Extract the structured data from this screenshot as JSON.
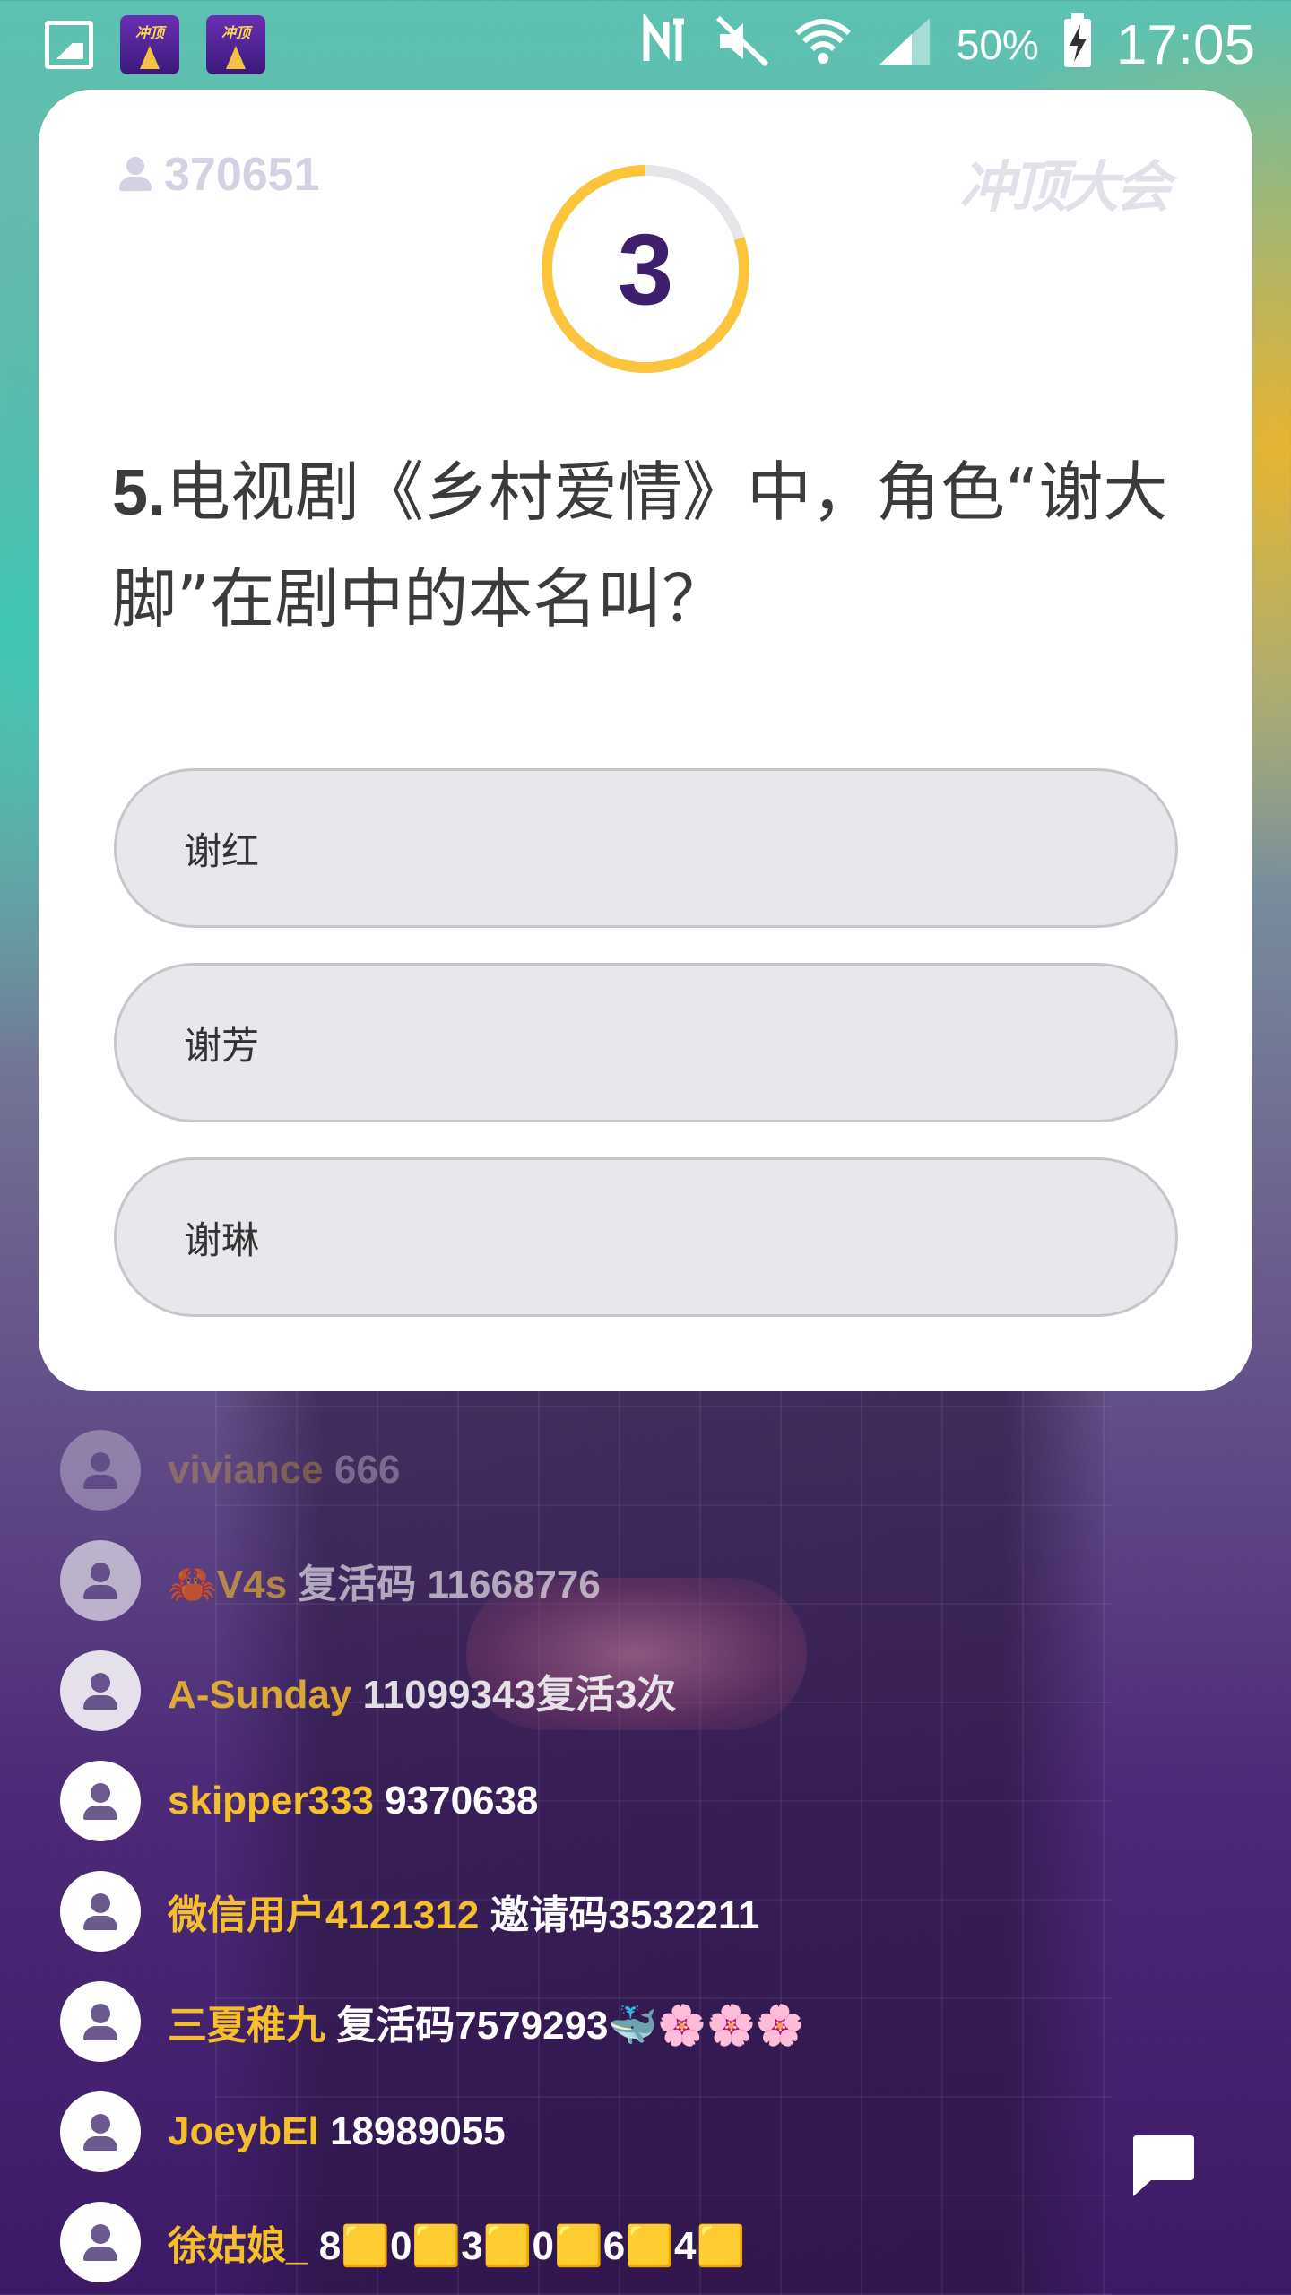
{
  "status_bar": {
    "battery": "50%",
    "time": "17:05",
    "app_icon_text": "冲顶"
  },
  "card": {
    "viewer_count": "370651",
    "logo_text": "冲顶大会",
    "countdown": "3",
    "countdown_progress": 0.8,
    "question_number": "5.",
    "question_text": "电视剧《乡村爱情》中，角色“谢大脚”在剧中的本名叫？",
    "options": [
      "谢红",
      "谢芳",
      "谢琳"
    ]
  },
  "comments": [
    {
      "user": "viviance",
      "message": " 666"
    },
    {
      "user": "🦀V4s",
      "message": " 复活码 11668776"
    },
    {
      "user": "A-Sunday",
      "message": " 11099343复活3次"
    },
    {
      "user": "skipper333",
      "message": " 9370638"
    },
    {
      "user": "微信用户4121312",
      "message": " 邀请码3532211"
    },
    {
      "user": "三夏稚九",
      "message": " 复活码7579293🐳🌸🌸🌸"
    },
    {
      "user": "JoeybEl",
      "message": " 18989055"
    },
    {
      "user": "徐姑娘_",
      "message": " 8🟨0🟨3🟨0🟨6🟨4🟨"
    }
  ],
  "colors": {
    "accent_yellow": "#f5bf2b",
    "timer_yellow": "#fbc43a",
    "timer_track": "#e6e5ea",
    "question_purple": "#3e1f6d"
  }
}
